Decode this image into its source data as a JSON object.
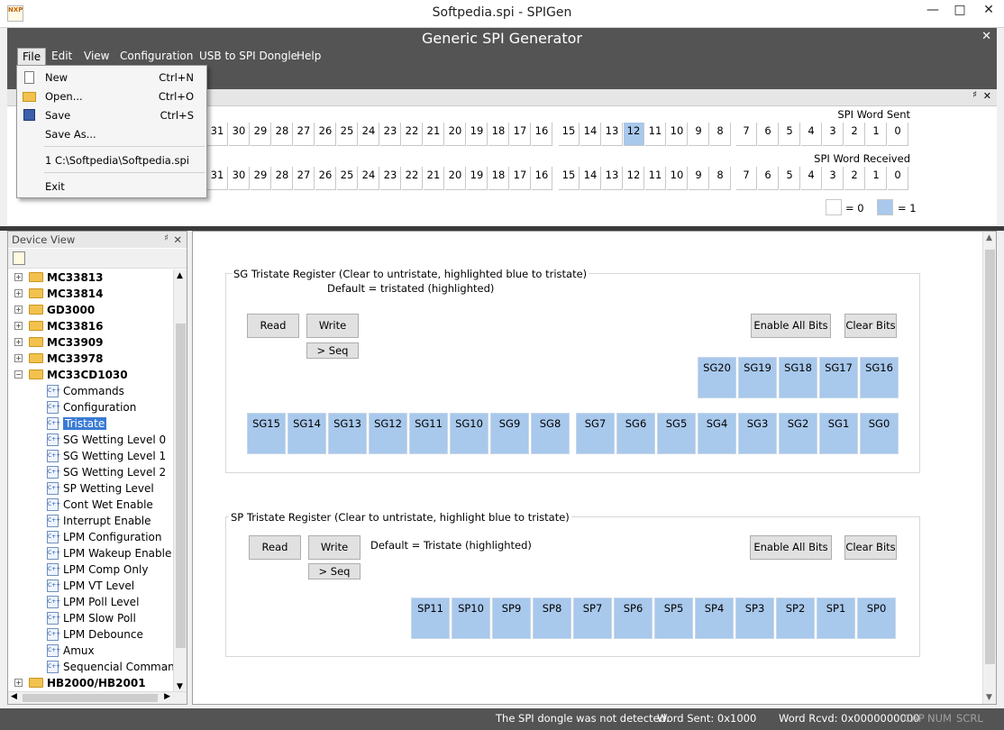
{
  "window": {
    "title": "Softpedia.spi - SPIGen",
    "app_icon_text": "NXP"
  },
  "header": {
    "title": "Generic SPI Generator"
  },
  "menubar": [
    "File",
    "Edit",
    "View",
    "Configuration",
    "USB to SPI Dongle",
    "Help"
  ],
  "file_menu": {
    "items": [
      {
        "label": "New",
        "shortcut": "Ctrl+N",
        "icon": "new-document-icon"
      },
      {
        "label": "Open...",
        "shortcut": "Ctrl+O",
        "icon": "open-folder-icon"
      },
      {
        "label": "Save",
        "shortcut": "Ctrl+S",
        "icon": "save-disk-icon"
      },
      {
        "label": "Save As...",
        "shortcut": "",
        "icon": ""
      }
    ],
    "recent": "1 C:\\Softpedia\\Softpedia.spi",
    "exit": "Exit"
  },
  "spi_word": {
    "sent_label": "SPI Word Sent",
    "received_label": "SPI Word Received",
    "bits": [
      "31",
      "30",
      "29",
      "28",
      "27",
      "26",
      "25",
      "24",
      "23",
      "22",
      "21",
      "20",
      "19",
      "18",
      "17",
      "16",
      "15",
      "14",
      "13",
      "12",
      "11",
      "10",
      "9",
      "8",
      "7",
      "6",
      "5",
      "4",
      "3",
      "2",
      "1",
      "0"
    ],
    "sent_highlighted": [
      "12"
    ],
    "legend_zero": "= 0",
    "legend_one": "= 1",
    "colors": {
      "one": "#a8c8ec",
      "zero": "#ffffff"
    }
  },
  "device_view": {
    "title": "Device View",
    "devices": [
      "MC33813",
      "MC33814",
      "GD3000",
      "MC33816",
      "MC33909",
      "MC33978",
      "MC33CD1030"
    ],
    "expanded_device": "MC33CD1030",
    "children": [
      "Commands",
      "Configuration",
      "Tristate",
      "SG Wetting Level 0",
      "SG Wetting Level 1",
      "SG Wetting Level 2",
      "SP Wetting Level",
      "Cont Wet Enable",
      "Interrupt Enable",
      "LPM Configuration",
      "LPM Wakeup Enable",
      "LPM Comp Only",
      "LPM VT Level",
      "LPM Poll Level",
      "LPM Slow Poll",
      "LPM Debounce",
      "Amux",
      "Sequencial Commands"
    ],
    "selected": "Tristate",
    "last_device": "HB2000/HB2001"
  },
  "sg_group": {
    "title": "SG Tristate Register (Clear to untristate, highlighted blue to tristate)",
    "default": "Default = tristated (highlighted)",
    "read": "Read",
    "write": "Write",
    "seq": "> Seq",
    "enable_all": "Enable All Bits",
    "clear": "Clear Bits",
    "row1": [
      "SG20",
      "SG19",
      "SG18",
      "SG17",
      "SG16"
    ],
    "row2a": [
      "SG15",
      "SG14",
      "SG13",
      "SG12",
      "SG11",
      "SG10",
      "SG9",
      "SG8"
    ],
    "row2b": [
      "SG7",
      "SG6",
      "SG5",
      "SG4",
      "SG3",
      "SG2",
      "SG1",
      "SG0"
    ]
  },
  "sp_group": {
    "title": "SP Tristate Register (Clear to untristate, highlight blue to tristate)",
    "default": "Default = Tristate (highlighted)",
    "read": "Read",
    "write": "Write",
    "seq": "> Seq",
    "enable_all": "Enable All Bits",
    "clear": "Clear Bits",
    "row": [
      "SP11",
      "SP10",
      "SP9",
      "SP8",
      "SP7",
      "SP6",
      "SP5",
      "SP4",
      "SP3",
      "SP2",
      "SP1",
      "SP0"
    ]
  },
  "status": {
    "message": "The SPI dongle was not detected.",
    "word_sent": "Word Sent: 0x1000",
    "word_rcvd": "Word Rcvd: 0x0000000000",
    "cap": "CAP",
    "num": "NUM",
    "scrl": "SCRL"
  }
}
